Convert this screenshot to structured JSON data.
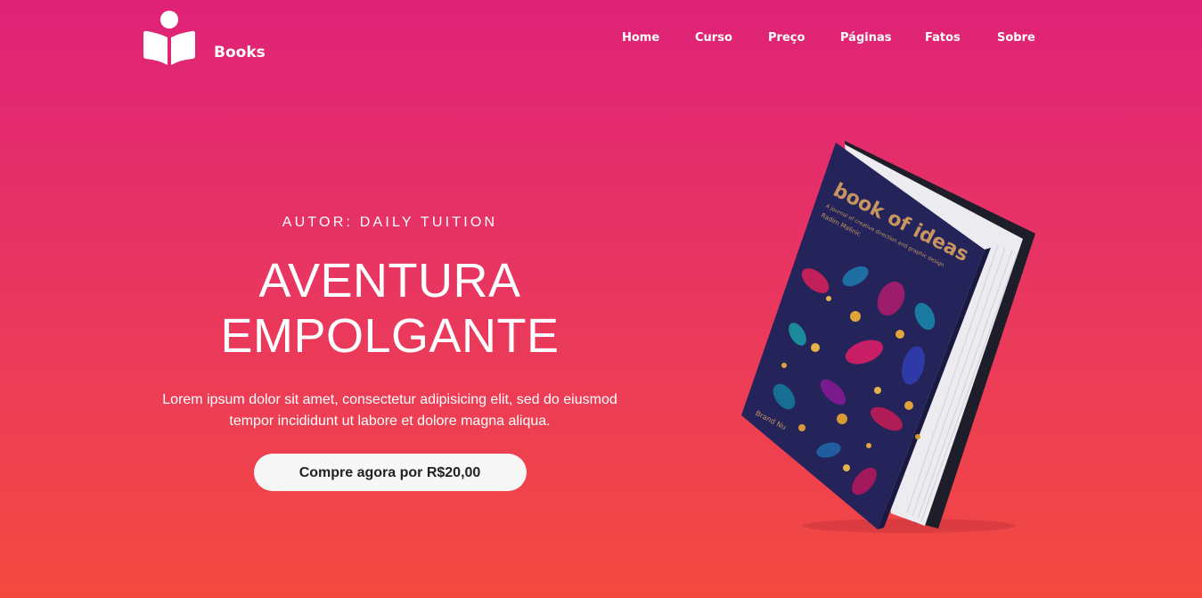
{
  "brand": {
    "name": "Books",
    "icon": "open-book-reader-icon"
  },
  "nav": {
    "items": [
      {
        "label": "Home"
      },
      {
        "label": "Curso"
      },
      {
        "label": "Preço"
      },
      {
        "label": "Páginas"
      },
      {
        "label": "Fatos"
      },
      {
        "label": "Sobre"
      }
    ]
  },
  "hero": {
    "author": "AUTOR: DAILY TUITION",
    "title_line1": "AVENTURA",
    "title_line2": "EMPOLGANTE",
    "description": "Lorem ipsum dolor sit amet, consectetur adipisicing elit, sed do eiusmod tempor incididunt ut labore et dolore magna aliqua.",
    "cta_label": "Compre agora por R$20,00"
  },
  "book": {
    "cover_title": "book of ideas",
    "cover_subtitle": "A journal of creative direction and graphic design",
    "cover_author": "Radim Malinic",
    "cover_brand": "Brand Nu"
  },
  "colors": {
    "gradient_top": "#df2277",
    "gradient_bottom": "#f34a40",
    "cta_background": "#f7f7f8",
    "cover_navy": "#25245a",
    "cover_title_gold": "#c8945f"
  }
}
